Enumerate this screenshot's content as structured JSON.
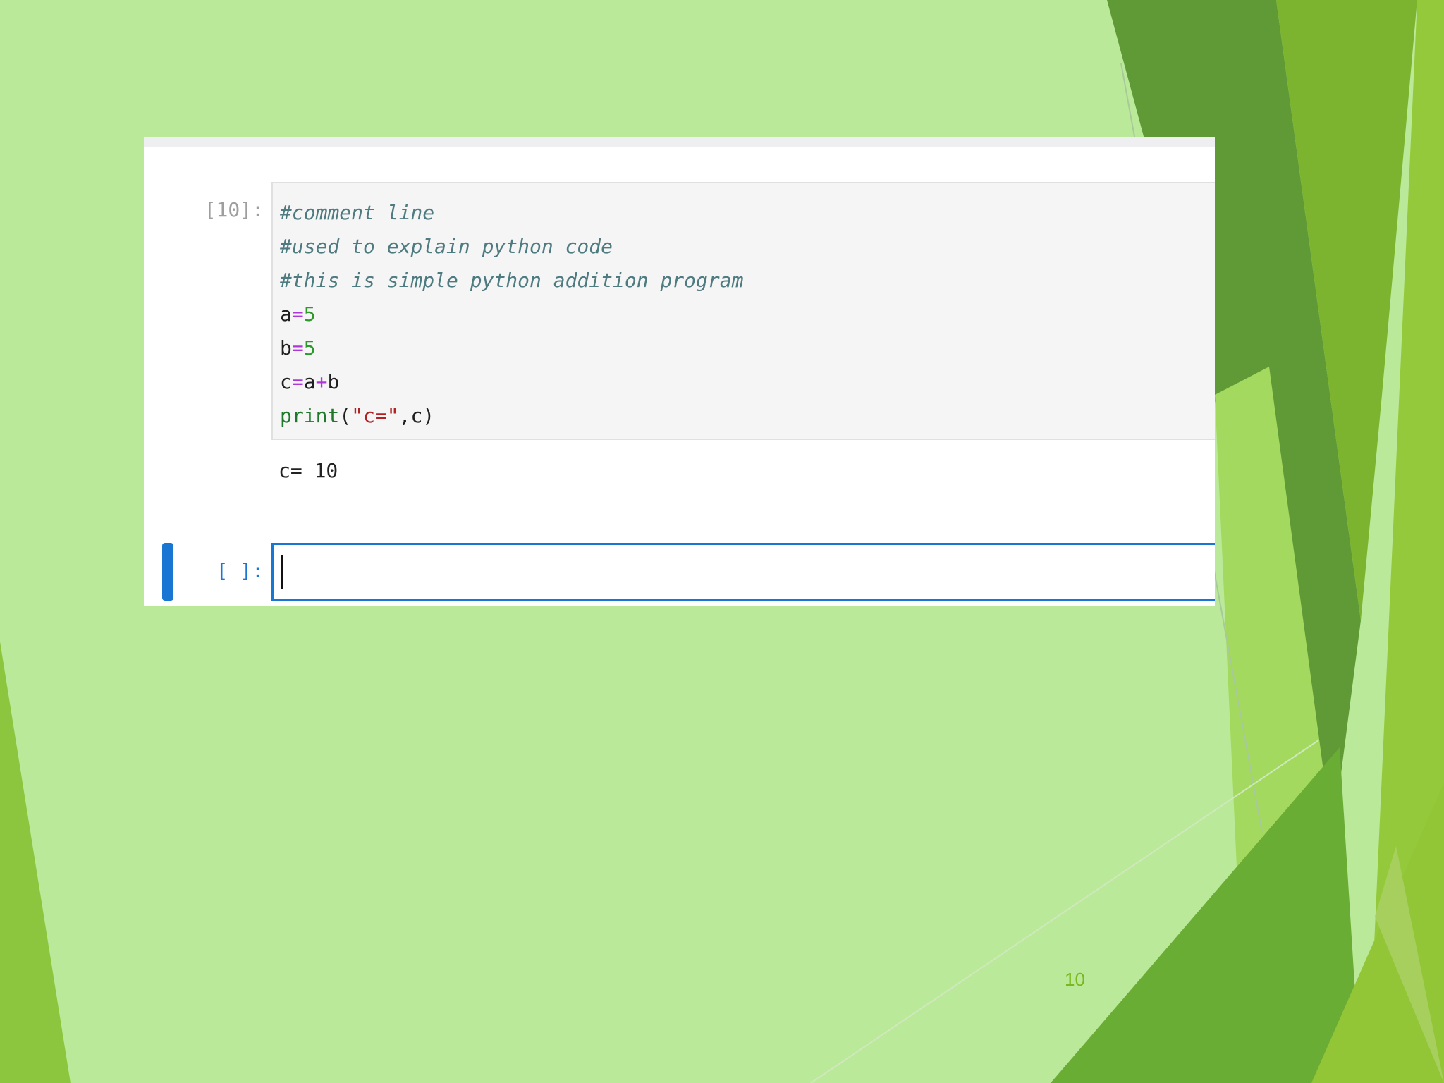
{
  "slide": {
    "number": "10",
    "colors": {
      "background": "#bbe99a",
      "accent_green": "#7ab81f",
      "cell_active": "#1976d2"
    }
  },
  "notebook": {
    "code_cell": {
      "prompt": "[10]:",
      "lines": [
        {
          "tokens": [
            {
              "t": "#comment line",
              "c": "comment"
            }
          ]
        },
        {
          "tokens": [
            {
              "t": "#used to explain python code",
              "c": "comment"
            }
          ]
        },
        {
          "tokens": [
            {
              "t": "#this is simple python addition program",
              "c": "comment"
            }
          ]
        },
        {
          "tokens": [
            {
              "t": "a",
              "c": "var"
            },
            {
              "t": "=",
              "c": "op"
            },
            {
              "t": "5",
              "c": "num"
            }
          ]
        },
        {
          "tokens": [
            {
              "t": "b",
              "c": "var"
            },
            {
              "t": "=",
              "c": "op"
            },
            {
              "t": "5",
              "c": "num"
            }
          ]
        },
        {
          "tokens": [
            {
              "t": "c",
              "c": "var"
            },
            {
              "t": "=",
              "c": "op"
            },
            {
              "t": "a",
              "c": "var"
            },
            {
              "t": "+",
              "c": "op"
            },
            {
              "t": "b",
              "c": "var"
            }
          ]
        },
        {
          "tokens": [
            {
              "t": "print",
              "c": "builtin"
            },
            {
              "t": "(",
              "c": "var"
            },
            {
              "t": "\"c=\"",
              "c": "str"
            },
            {
              "t": ",c)",
              "c": "var"
            }
          ]
        }
      ],
      "output": "c= 10"
    },
    "empty_cell": {
      "prompt": "[ ]:",
      "value": ""
    }
  }
}
